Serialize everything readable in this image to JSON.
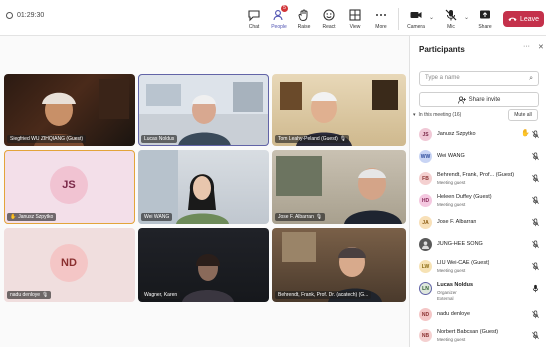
{
  "window": {
    "timer": "01:29:30"
  },
  "toolbar": {
    "chat": "Chat",
    "people": "People",
    "people_badge": "5",
    "raise": "Raise",
    "react": "React",
    "view": "View",
    "more": "More",
    "camera": "Camera",
    "mic": "Mic",
    "share": "Share",
    "leave": "Leave"
  },
  "tiles": [
    {
      "name": "Siegfried WU ZIHQIANG (Guest)"
    },
    {
      "name": "Lucas Noldus"
    },
    {
      "name": "Tom Leahy-Peland (Guest)"
    },
    {
      "name": "Janusz Szpytko",
      "initials": "JS"
    },
    {
      "name": "Wei WANG"
    },
    {
      "name": "Jose F. Albarran"
    },
    {
      "name": "nadu denloye",
      "initials": "ND"
    },
    {
      "name": "Wagner, Karen"
    },
    {
      "name": "Behrendt, Frank, Prof. Dr. (acatech) (G..."
    }
  ],
  "panel": {
    "title": "Participants",
    "search_placeholder": "Type a name",
    "share_invite": "Share invite",
    "section": "In this meeting (16)",
    "mute_all": "Mute all",
    "participants": [
      {
        "initials": "JS",
        "name": "Janusz Szpytko",
        "sub": "",
        "hand": true
      },
      {
        "initials": "WW",
        "name": "Wei WANG",
        "sub": ""
      },
      {
        "initials": "FB",
        "name": "Behrendt, Frank, Prof... (Guest)",
        "sub": "Meeting guest"
      },
      {
        "initials": "HD",
        "name": "Heleen Duffey (Guest)",
        "sub": "Meeting guest"
      },
      {
        "initials": "JA",
        "name": "Jose F. Albarran",
        "sub": ""
      },
      {
        "initials": "",
        "name": "JUNG-HEE SONG",
        "sub": ""
      },
      {
        "initials": "LW",
        "name": "LIU Wei-CAE (Guest)",
        "sub": "Meeting guest"
      },
      {
        "initials": "LN",
        "name": "Lucas Noldus",
        "sub": "Organizer",
        "sub2": "External"
      },
      {
        "initials": "ND",
        "name": "nadu denloye",
        "sub": ""
      },
      {
        "initials": "NB",
        "name": "Norbert Babcsan (Guest)",
        "sub": "Meeting guest"
      }
    ]
  },
  "colors": {
    "leave": "#c4314b",
    "accent": "#5b5fc7",
    "active_border": "#e3a43a"
  }
}
